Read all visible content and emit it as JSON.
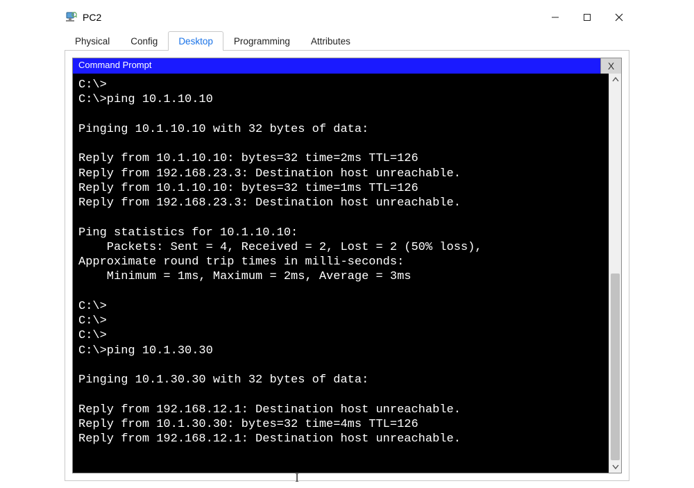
{
  "window": {
    "title": "PC2",
    "buttons": {
      "min": "—",
      "max": "☐",
      "close": "✕"
    }
  },
  "tabs": [
    {
      "label": "Physical",
      "active": false
    },
    {
      "label": "Config",
      "active": false
    },
    {
      "label": "Desktop",
      "active": true
    },
    {
      "label": "Programming",
      "active": false
    },
    {
      "label": "Attributes",
      "active": false
    }
  ],
  "cmd_panel": {
    "title": "Command Prompt",
    "close_label": "X"
  },
  "terminal_lines": [
    "C:\\>",
    "C:\\>ping 10.1.10.10",
    "",
    "Pinging 10.1.10.10 with 32 bytes of data:",
    "",
    "Reply from 10.1.10.10: bytes=32 time=2ms TTL=126",
    "Reply from 192.168.23.3: Destination host unreachable.",
    "Reply from 10.1.10.10: bytes=32 time=1ms TTL=126",
    "Reply from 192.168.23.3: Destination host unreachable.",
    "",
    "Ping statistics for 10.1.10.10:",
    "    Packets: Sent = 4, Received = 2, Lost = 2 (50% loss),",
    "Approximate round trip times in milli-seconds:",
    "    Minimum = 1ms, Maximum = 2ms, Average = 3ms",
    "",
    "C:\\>",
    "C:\\>",
    "C:\\>",
    "C:\\>ping 10.1.30.30",
    "",
    "Pinging 10.1.30.30 with 32 bytes of data:",
    "",
    "Reply from 192.168.12.1: Destination host unreachable.",
    "Reply from 10.1.30.30: bytes=32 time=4ms TTL=126",
    "Reply from 192.168.12.1: Destination host unreachable."
  ],
  "scroll": {
    "thumb_top_pct": 50,
    "thumb_height_pct": 50
  }
}
